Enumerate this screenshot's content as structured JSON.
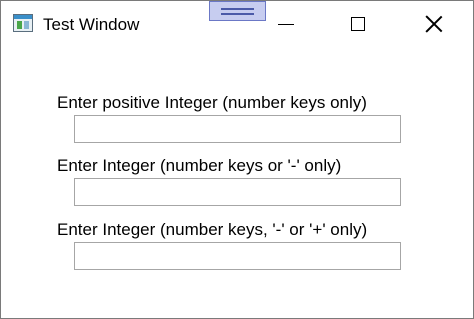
{
  "window": {
    "title": "Test Window"
  },
  "form": {
    "fields": [
      {
        "label": "Enter positive Integer (number keys only)",
        "value": ""
      },
      {
        "label": "Enter Integer (number keys or '-' only)",
        "value": ""
      },
      {
        "label": "Enter Integer (number keys, '-' or '+' only)",
        "value": ""
      }
    ]
  }
}
